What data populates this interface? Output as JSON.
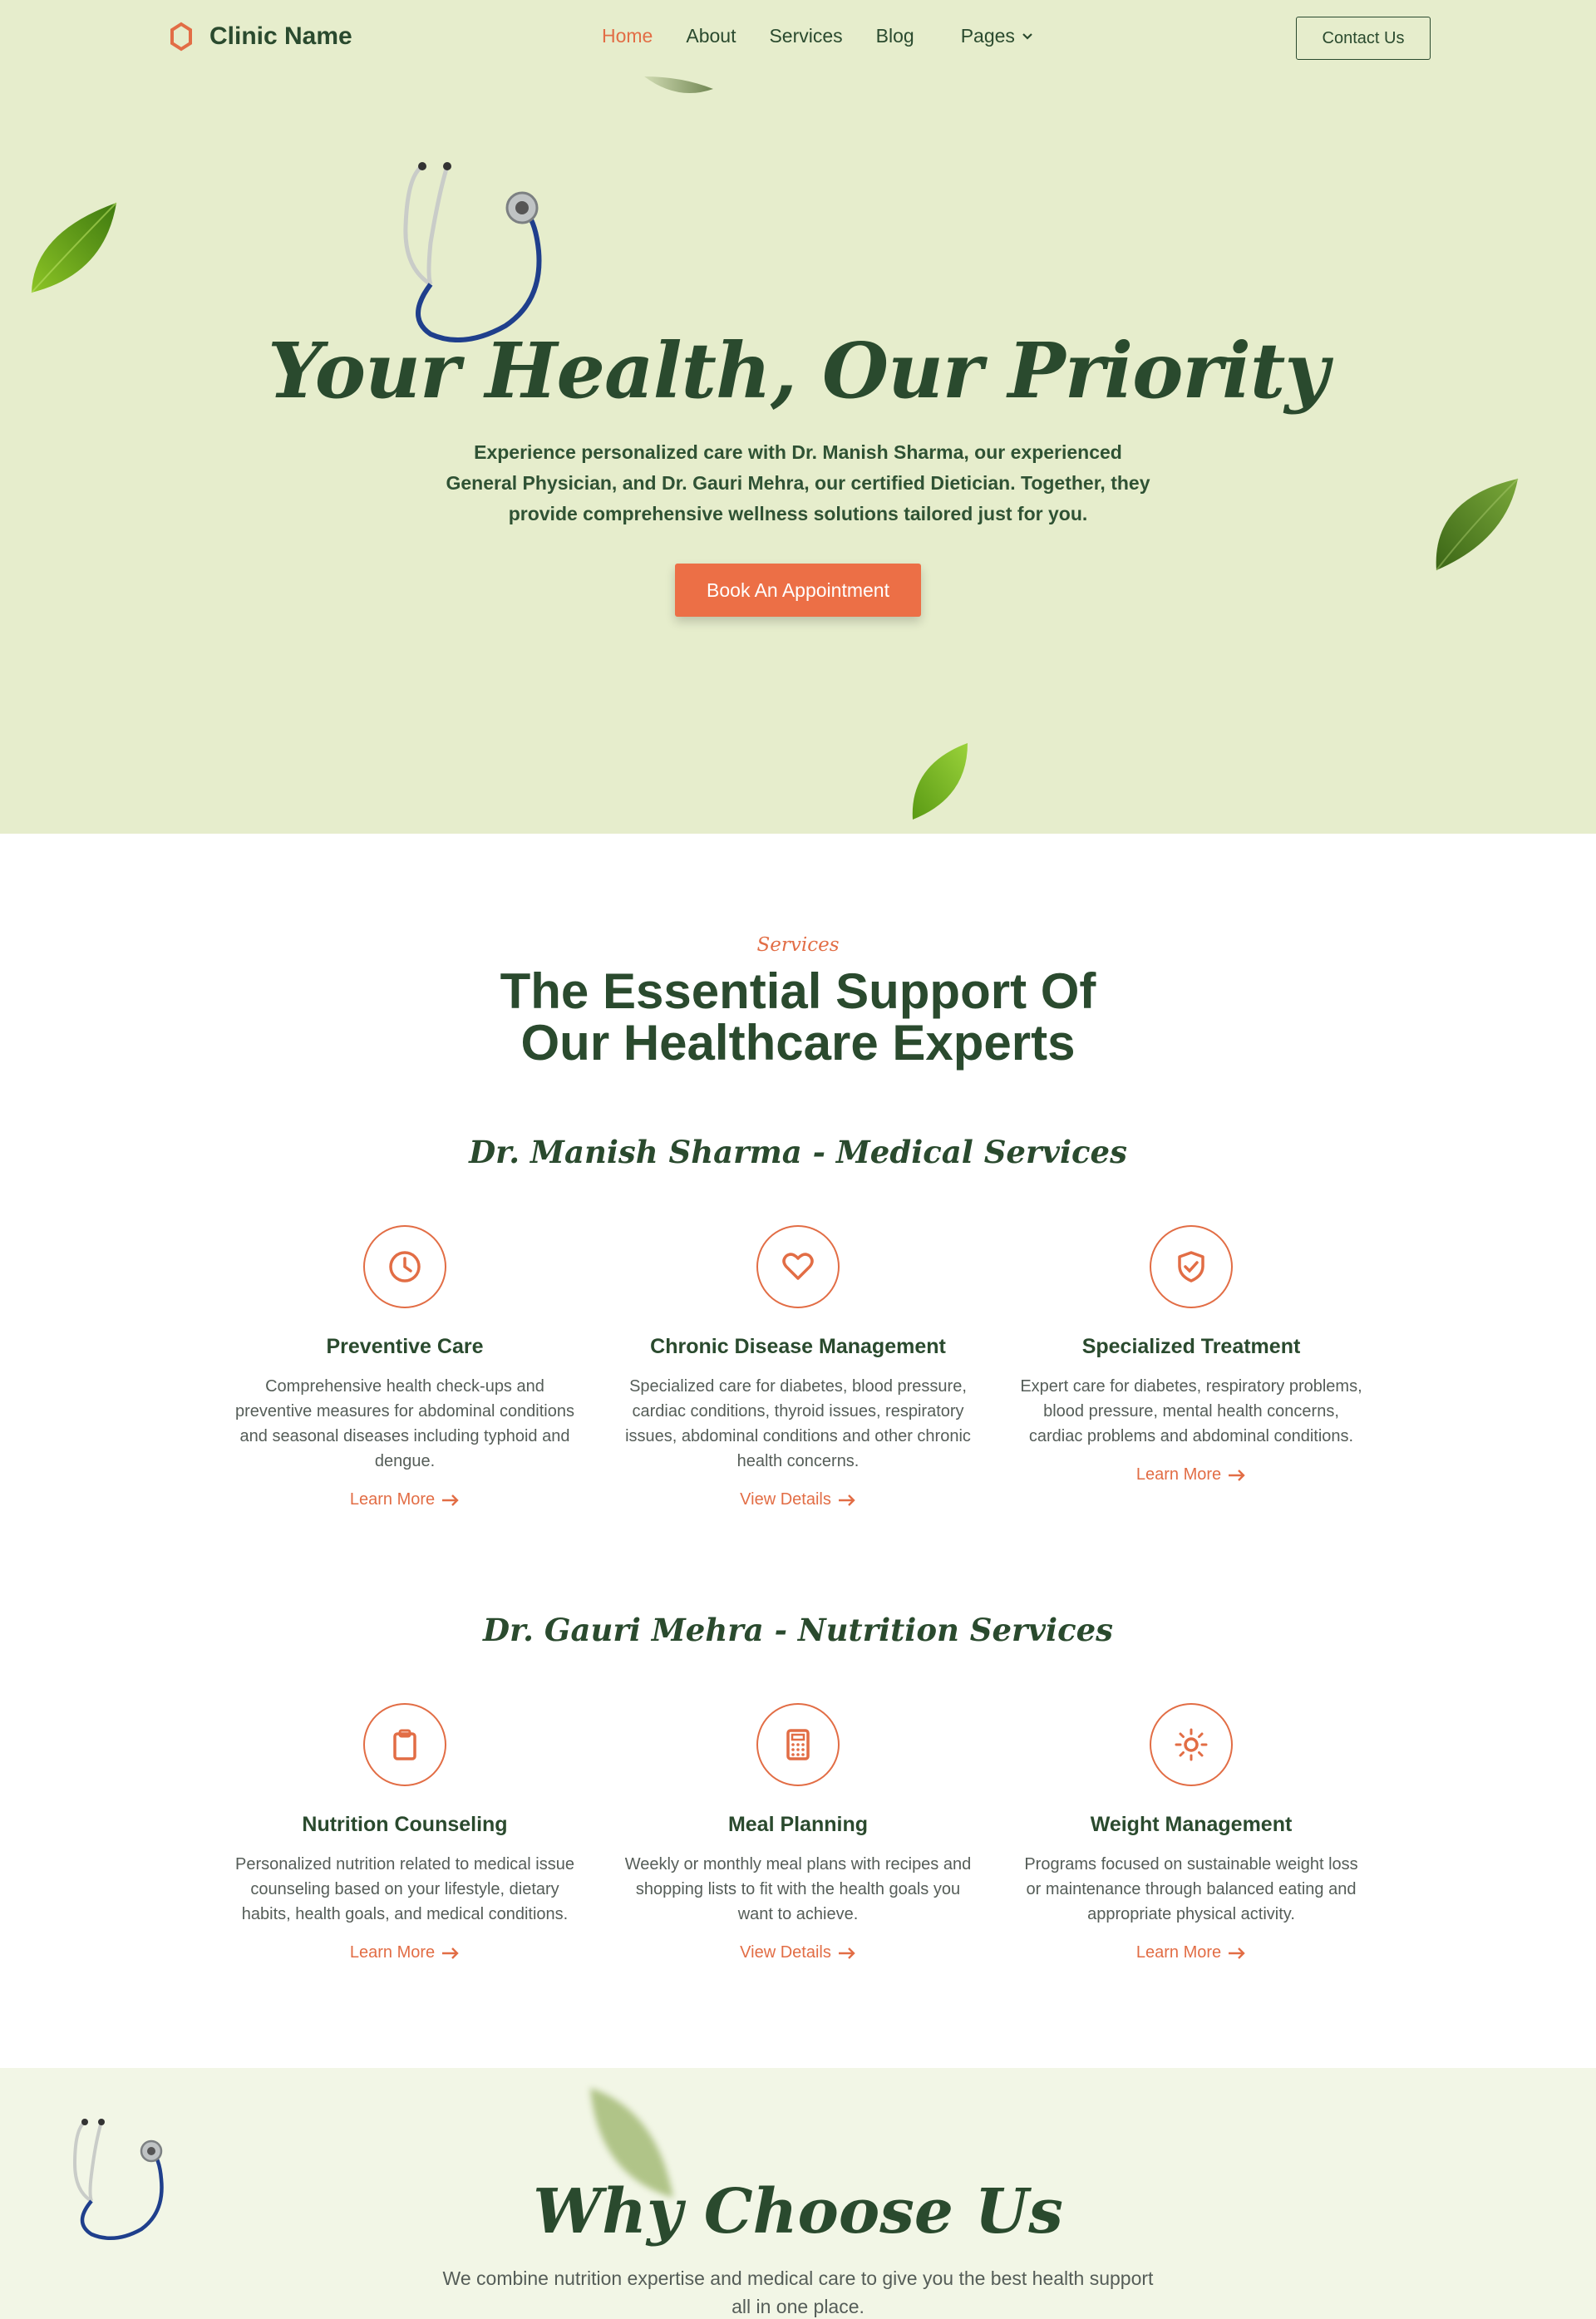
{
  "header": {
    "brand": "Clinic Name",
    "nav": [
      {
        "label": "Home",
        "active": true
      },
      {
        "label": "About",
        "active": false
      },
      {
        "label": "Services",
        "active": false
      },
      {
        "label": "Blog",
        "active": false
      },
      {
        "label": "Pages",
        "active": false,
        "dropdown": true
      }
    ],
    "contact_label": "Contact Us"
  },
  "hero": {
    "title": "Your Health, Our Priority",
    "subtitle": "Experience personalized care with Dr. Manish Sharma, our experienced General Physician, and Dr. Gauri Mehra, our certified Dietician. Together, they provide comprehensive wellness solutions tailored just for you.",
    "cta": "Book An Appointment"
  },
  "services": {
    "eyebrow": "Services",
    "title_line1": "The Essential Support Of",
    "title_line2": "Our Healthcare Experts",
    "groups": [
      {
        "heading": "Dr. Manish Sharma - Medical Services",
        "cards": [
          {
            "icon": "clock-icon",
            "title": "Preventive Care",
            "desc": "Comprehensive health check-ups and preventive measures for abdominal conditions and seasonal diseases including typhoid and dengue.",
            "link": "Learn More"
          },
          {
            "icon": "heart-icon",
            "title": "Chronic Disease Management",
            "desc": "Specialized care for diabetes, blood pressure, cardiac conditions, thyroid issues, respiratory issues, abdominal conditions and other chronic health concerns.",
            "link": "View Details"
          },
          {
            "icon": "shield-check-icon",
            "title": "Specialized Treatment",
            "desc": "Expert care for diabetes, respiratory problems, blood pressure, mental health concerns, cardiac problems and abdominal conditions.",
            "link": "Learn More"
          }
        ]
      },
      {
        "heading": "Dr. Gauri Mehra - Nutrition Services",
        "cards": [
          {
            "icon": "clipboard-icon",
            "title": "Nutrition Counseling",
            "desc": "Personalized nutrition related to medical issue counseling based on your lifestyle, dietary habits, health goals, and medical conditions.",
            "link": "Learn More"
          },
          {
            "icon": "calculator-icon",
            "title": "Meal Planning",
            "desc": "Weekly or monthly meal plans with recipes and shopping lists to fit with the health goals you want to achieve.",
            "link": "View Details"
          },
          {
            "icon": "sun-icon",
            "title": "Weight Management",
            "desc": "Programs focused on sustainable weight loss or maintenance through balanced eating and appropriate physical activity.",
            "link": "Learn More"
          }
        ]
      }
    ]
  },
  "why": {
    "title": "Why Choose Us",
    "subtitle": "We combine nutrition expertise and medical care to give you the best health support all in one place."
  },
  "colors": {
    "accent": "#e26d45",
    "primary": "#2a4a2e",
    "hero_bg": "#e6edcc",
    "why_bg": "#f2f6e6"
  }
}
